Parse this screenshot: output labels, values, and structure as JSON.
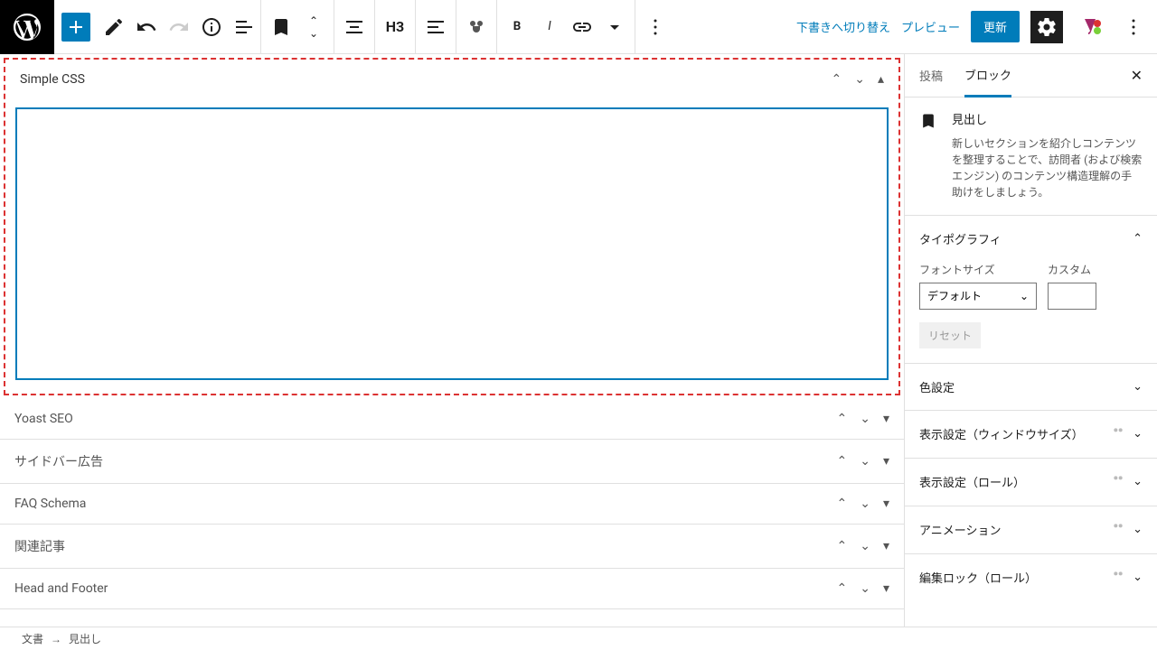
{
  "topbar": {
    "h3_label": "H3",
    "draft_switch": "下書きへ切り替え",
    "preview": "プレビュー",
    "update": "更新"
  },
  "editor": {
    "panels": [
      {
        "title": "Simple CSS",
        "expanded": true,
        "highlighted": true
      },
      {
        "title": "Yoast SEO",
        "expanded": false
      },
      {
        "title": "サイドバー広告",
        "expanded": false
      },
      {
        "title": "FAQ Schema",
        "expanded": false
      },
      {
        "title": "関連記事",
        "expanded": false
      },
      {
        "title": "Head and Footer",
        "expanded": false
      }
    ]
  },
  "sidebar": {
    "tabs": {
      "post": "投稿",
      "block": "ブロック"
    },
    "block": {
      "name": "見出し",
      "desc": "新しいセクションを紹介しコンテンツを整理することで、訪問者 (および検索エンジン) のコンテンツ構造理解の手助けをしましょう。"
    },
    "typo": {
      "title": "タイポグラフィ",
      "font_size": "フォントサイズ",
      "custom": "カスタム",
      "default": "デフォルト",
      "reset": "リセット"
    },
    "sections": {
      "color": "色設定",
      "display_window": "表示設定（ウィンドウサイズ）",
      "display_role": "表示設定（ロール）",
      "animation": "アニメーション",
      "edit_lock": "編集ロック（ロール）"
    }
  },
  "breadcrumb": {
    "doc": "文書",
    "sep": "→",
    "block": "見出し"
  }
}
